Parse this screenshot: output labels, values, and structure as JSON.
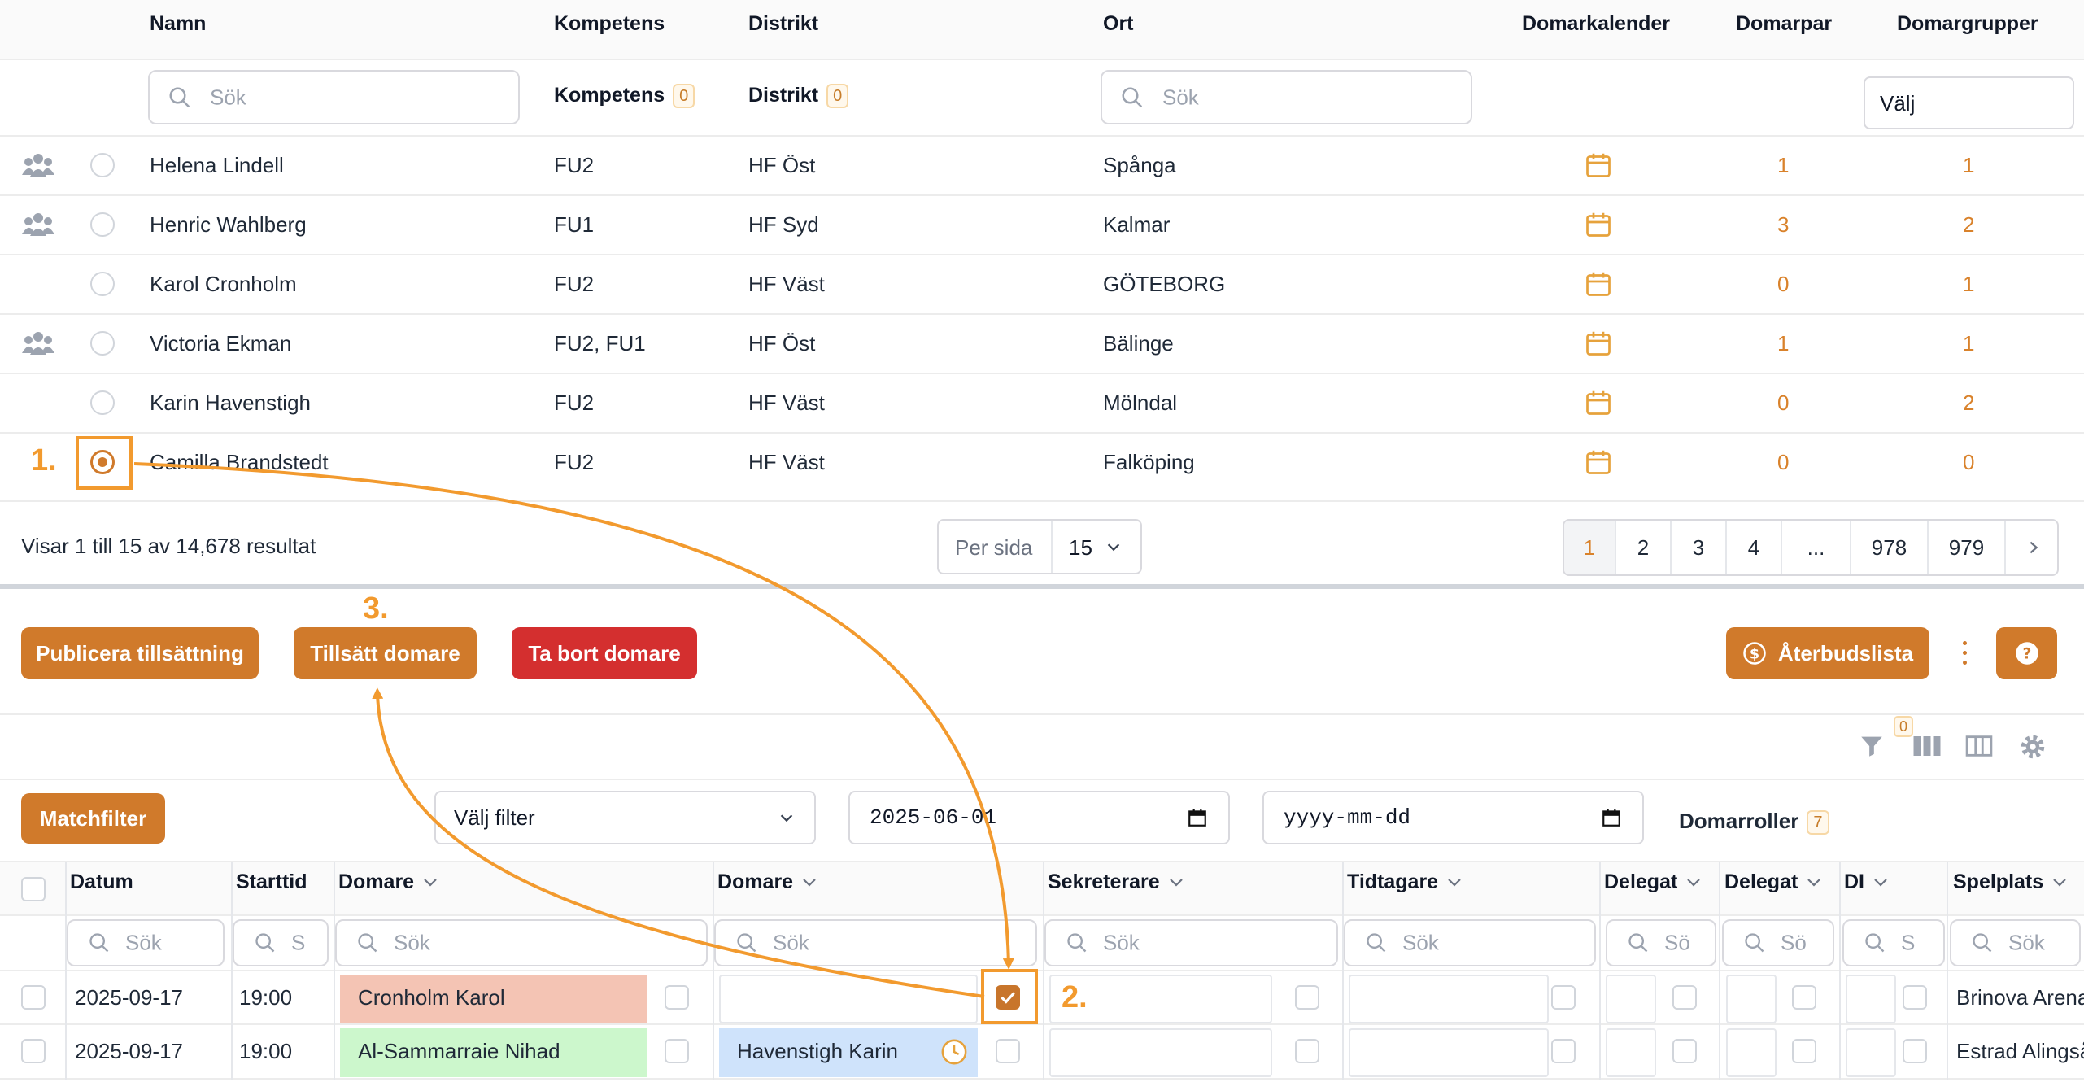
{
  "top_table": {
    "columns": {
      "namn": "Namn",
      "kompetens": "Kompetens",
      "distrikt": "Distrikt",
      "ort": "Ort",
      "domarkalender": "Domarkalender",
      "domarpar": "Domarpar",
      "domargrupper": "Domargrupper"
    },
    "filters": {
      "name_placeholder": "Sök",
      "kompetens_label": "Kompetens",
      "kompetens_count": "0",
      "distrikt_label": "Distrikt",
      "distrikt_count": "0",
      "ort_placeholder": "Sök",
      "domargrupper_select": "Välj"
    },
    "rows": [
      {
        "name": "Helena Lindell",
        "kompetens": "FU2",
        "distrikt": "HF Öst",
        "ort": "Spånga",
        "domarpar": "1",
        "domargrupper": "1",
        "group_icon": true
      },
      {
        "name": "Henric Wahlberg",
        "kompetens": "FU1",
        "distrikt": "HF Syd",
        "ort": "Kalmar",
        "domarpar": "3",
        "domargrupper": "2",
        "group_icon": true
      },
      {
        "name": "Karol Cronholm",
        "kompetens": "FU2",
        "distrikt": "HF Väst",
        "ort": "GÖTEBORG",
        "domarpar": "0",
        "domargrupper": "1",
        "group_icon": false
      },
      {
        "name": "Victoria Ekman",
        "kompetens": "FU2, FU1",
        "distrikt": "HF Öst",
        "ort": "Bälinge",
        "domarpar": "1",
        "domargrupper": "1",
        "group_icon": true
      },
      {
        "name": "Karin Havenstigh",
        "kompetens": "FU2",
        "distrikt": "HF Väst",
        "ort": "Mölndal",
        "domarpar": "0",
        "domargrupper": "2",
        "group_icon": false
      },
      {
        "name": "Camilla Brandstedt",
        "kompetens": "FU2",
        "distrikt": "HF Väst",
        "ort": "Falköping",
        "domarpar": "0",
        "domargrupper": "0",
        "group_icon": false,
        "selected": true
      }
    ],
    "results_text": "Visar 1 till 15 av 14,678 resultat",
    "per_page_label": "Per sida",
    "per_page_value": "15",
    "pages": [
      "1",
      "2",
      "3",
      "4",
      "...",
      "978",
      "979"
    ]
  },
  "actions": {
    "publish": "Publicera tillsättning",
    "assign": "Tillsätt domare",
    "remove": "Ta bort domare",
    "aterbud": "Återbudslista"
  },
  "toolbar": {
    "filter_count": "0"
  },
  "match_filters": {
    "matchfilter_button": "Matchfilter",
    "filter_select": "Välj filter",
    "date_from": "2025-06-01",
    "date_to_placeholder": "yyyy-mm-dd",
    "domarroller_label": "Domarroller",
    "domarroller_count": "7"
  },
  "match_table": {
    "columns": {
      "datum": "Datum",
      "starttid": "Starttid",
      "domare1": "Domare",
      "domare2": "Domare",
      "sekreterare": "Sekreterare",
      "tidtagare": "Tidtagare",
      "delegat1": "Delegat",
      "delegat2": "Delegat",
      "di": "DI",
      "spelplats": "Spelplats"
    },
    "search": {
      "datum": "Sök",
      "starttid": "S",
      "domare1": "Sök",
      "domare2": "Sök",
      "sekreterare": "Sök",
      "tidtagare": "Sök",
      "delegat1": "Sö",
      "delegat2": "Sö",
      "di": "S",
      "spelplats": "Sök"
    },
    "rows": [
      {
        "datum": "2025-09-17",
        "starttid": "19:00",
        "domare1": "Cronholm Karol",
        "domare2": "",
        "spelplats": "Brinova Arena"
      },
      {
        "datum": "2025-09-17",
        "starttid": "19:00",
        "domare1": "Al-Sammarraie Nihad",
        "domare2": "Havenstigh Karin",
        "spelplats": "Estrad Alingsås"
      }
    ]
  },
  "annotations": {
    "step1": "1.",
    "step2": "2.",
    "step3": "3."
  },
  "colors": {
    "accent": "#d07a2b",
    "danger": "#d42f2f",
    "pink_cell": "#f4c4b4",
    "green_cell": "#ccf7cc",
    "blue_cell": "#cfe3fb",
    "annotation": "#f29a2e"
  }
}
